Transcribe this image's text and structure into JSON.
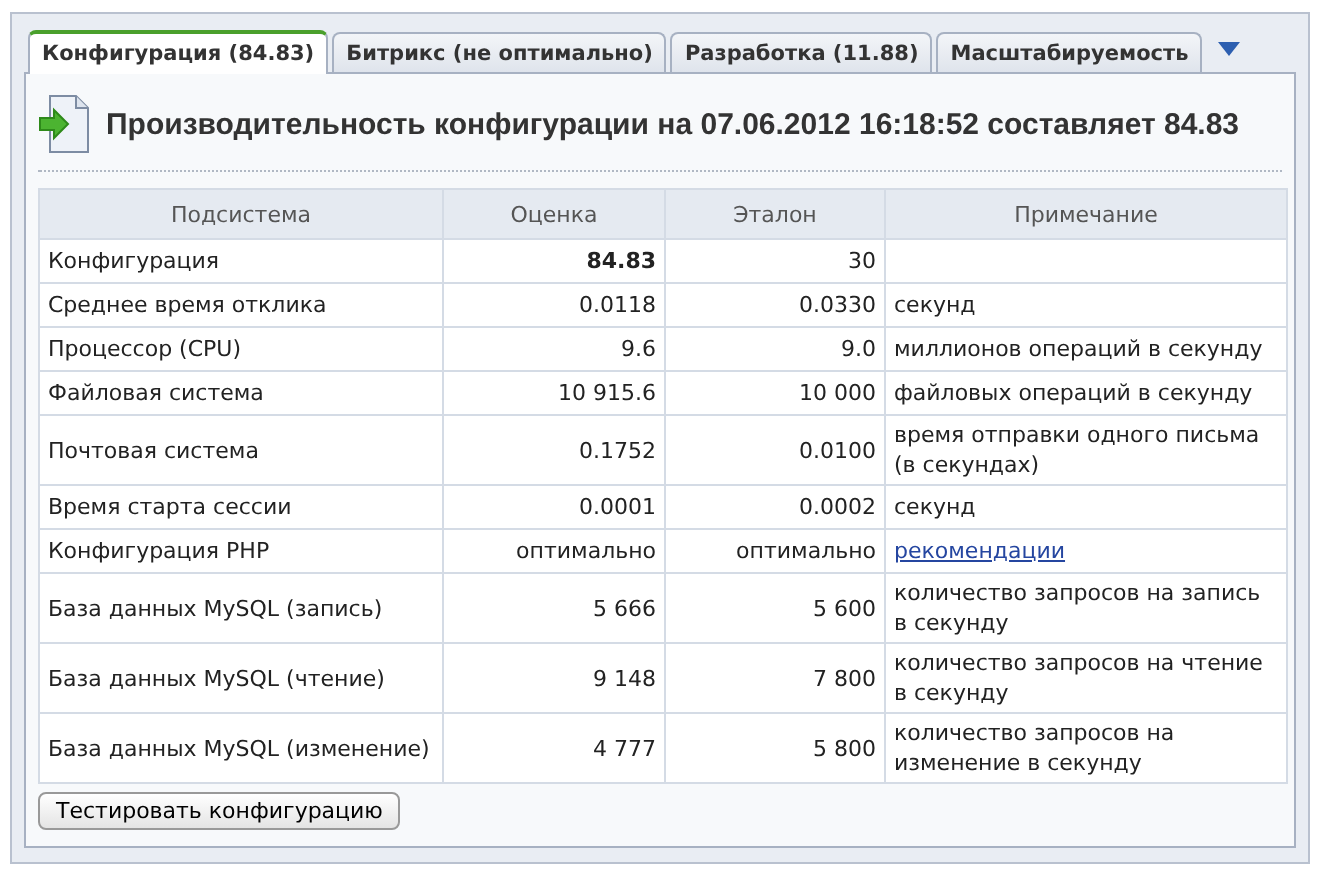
{
  "tabs": [
    {
      "label": "Конфигурация (84.83)",
      "selected": true
    },
    {
      "label": "Битрикс (не оптимально)",
      "selected": false
    },
    {
      "label": "Разработка (11.88)",
      "selected": false
    },
    {
      "label": "Масштабируемость",
      "selected": false
    }
  ],
  "heading": "Производительность конфигурации на 07.06.2012 16:18:52 составляет 84.83",
  "table": {
    "columns": [
      "Подсистема",
      "Оценка",
      "Эталон",
      "Примечание"
    ],
    "rows": [
      {
        "subsystem": "Конфигурация",
        "score": "84.83",
        "bold": true,
        "reference": "30"
      },
      {
        "subsystem": "Среднее время отклика",
        "score": "0.0118",
        "bold": false,
        "reference": "0.0330",
        "note": "секунд",
        "kind": "text"
      },
      {
        "subsystem": "Процессор (CPU)",
        "score": "9.6",
        "bold": false,
        "reference": "9.0",
        "note": "миллионов операций в секунду",
        "kind": "text"
      },
      {
        "subsystem": "Файловая система",
        "score": "10 915.6",
        "bold": false,
        "reference": "10 000",
        "note": "файловых операций в секунду",
        "kind": "text"
      },
      {
        "subsystem": "Почтовая система",
        "score": "0.1752",
        "bold": false,
        "reference": "0.0100",
        "note": "время отправки одного письма (в секундах)",
        "kind": "text"
      },
      {
        "subsystem": "Время старта сессии",
        "score": "0.0001",
        "bold": false,
        "reference": "0.0002",
        "note": "секунд",
        "kind": "text"
      },
      {
        "subsystem": "Конфигурация PHP",
        "score": "оптимально",
        "bold": false,
        "reference": "оптимально",
        "note": "рекомендации",
        "kind": "link"
      },
      {
        "subsystem": "База данных MySQL (запись)",
        "score": "5 666",
        "bold": false,
        "reference": "5 600",
        "note": "количество запросов на запись в секунду",
        "kind": "text"
      },
      {
        "subsystem": "База данных MySQL (чтение)",
        "score": "9 148",
        "bold": false,
        "reference": "7 800",
        "note": "количество запросов на чтение в секунду",
        "kind": "text"
      },
      {
        "subsystem": "База данных MySQL (изменение)",
        "score": "4 777",
        "bold": false,
        "reference": "5 800",
        "note": "количество запросов на изменение в секунду",
        "kind": "text"
      }
    ]
  },
  "button": "Тестировать конфигурацию"
}
